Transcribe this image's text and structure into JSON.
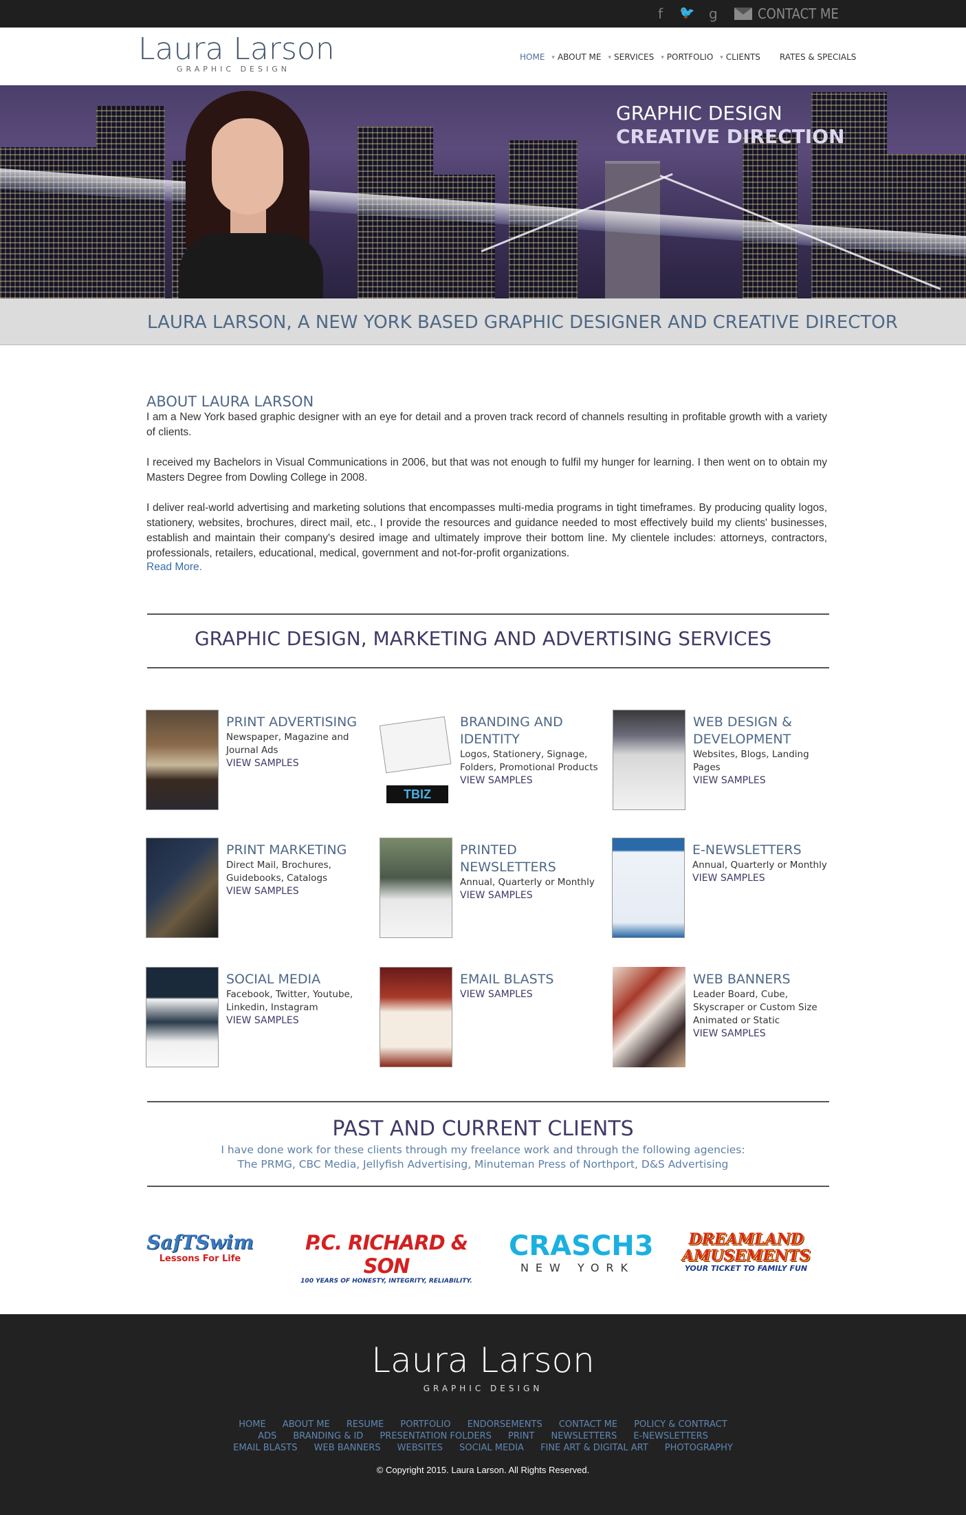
{
  "topbar": {
    "social": [
      "f",
      "twitter-bird",
      "g"
    ],
    "contact_label": "CONTACT ME"
  },
  "header": {
    "logo_name": "Laura Larson",
    "logo_tag": "GRAPHIC DESIGN",
    "nav": [
      "HOME",
      "ABOUT ME",
      "SERVICES",
      "PORTFOLIO",
      "CLIENTS",
      "RATES & SPECIALS"
    ]
  },
  "hero": {
    "line1": "GRAPHIC DESIGN",
    "line2": "CREATIVE DIRECTION"
  },
  "strip_title": "LAURA LARSON, A NEW YORK BASED GRAPHIC DESIGNER AND CREATIVE DIRECTOR",
  "about": {
    "heading": "ABOUT LAURA LARSON",
    "p1": "I am a New York based graphic designer with an eye for detail and a proven track record of channels resulting in profitable growth with a variety of clients.",
    "p2": "I received my Bachelors in Visual Communications in 2006, but that was not enough to fulfil my hunger for learning. I then went on to obtain my Masters Degree from Dowling College in 2008.",
    "p3": "I deliver real-world advertising and marketing solutions that encompasses multi-media programs in tight timeframes. By producing quality logos, stationery, websites, brochures, direct mail, etc., I provide the resources and guidance needed to most effectively build my clients' businesses, establish and maintain their company's desired image and ultimately improve their bottom line. My clientele includes: attorneys, contractors, professionals, retailers, educational, medical, government and not-for-profit organizations.",
    "read_more": "Read More."
  },
  "services_title": "GRAPHIC DESIGN, MARKETING AND ADVERTISING SERVICES",
  "services": [
    {
      "title": "PRINT ADVERTISING",
      "desc": "Newspaper, Magazine and Journal Ads",
      "link": "VIEW SAMPLES"
    },
    {
      "title": "BRANDING AND IDENTITY",
      "desc": "Logos, Stationery, Signage, Folders, Promotional Products",
      "link": "VIEW SAMPLES"
    },
    {
      "title": "WEB DESIGN & DEVELOPMENT",
      "desc": "Websites, Blogs, Landing Pages",
      "link": "VIEW SAMPLES"
    },
    {
      "title": "PRINT MARKETING",
      "desc": "Direct Mail, Brochures, Guidebooks, Catalogs",
      "link": "VIEW SAMPLES"
    },
    {
      "title": "PRINTED NEWSLETTERS",
      "desc": "Annual, Quarterly or Monthly",
      "link": "VIEW SAMPLES"
    },
    {
      "title": "E-NEWSLETTERS",
      "desc": "Annual, Quarterly or Monthly",
      "link": "VIEW SAMPLES"
    },
    {
      "title": "SOCIAL MEDIA",
      "desc": "Facebook, Twitter, Youtube, Linkedin, Instagram",
      "link": "VIEW SAMPLES"
    },
    {
      "title": "EMAIL BLASTS",
      "desc": "",
      "link": "VIEW SAMPLES"
    },
    {
      "title": "WEB BANNERS",
      "desc": "Leader Board, Cube, Skyscraper or Custom Size Animated or Static",
      "link": "VIEW SAMPLES"
    }
  ],
  "clients": {
    "title": "PAST AND CURRENT CLIENTS",
    "sub1": "I have done work for these clients through my freelance work and through the following agencies:",
    "sub2": "The PRMG, CBC Media, Jellyfish Advertising, Minuteman Press of Northport, D&S Advertising",
    "logos": [
      {
        "main": "SafTSwim",
        "sub": "Lessons For Life"
      },
      {
        "main": "P.C. RICHARD & SON",
        "sub": "100 YEARS OF HONESTY, INTEGRITY, RELIABILITY."
      },
      {
        "main": "CRASCH3",
        "sub": "NEW YORK"
      },
      {
        "main": "DREAMLAND AMUSEMENTS",
        "sub": "YOUR TICKET TO FAMILY FUN"
      }
    ]
  },
  "footer": {
    "logo_name": "Laura Larson",
    "logo_tag": "GRAPHIC DESIGN",
    "links_row1": [
      "HOME",
      "ABOUT ME",
      "RESUME",
      "PORTFOLIO",
      "ENDORSEMENTS",
      "CONTACT ME",
      "POLICY & CONTRACT"
    ],
    "links_row2": [
      "ADS",
      "BRANDING & ID",
      "PRESENTATION FOLDERS",
      "PRINT",
      "NEWSLETTERS",
      "E-NEWSLETTERS"
    ],
    "links_row3": [
      "EMAIL BLASTS",
      "WEB BANNERS",
      "WEBSITES",
      "SOCIAL MEDIA",
      "FINE ART & DIGITAL ART",
      "PHOTOGRAPHY"
    ],
    "copyright": "© Copyright 2015. Laura Larson. All Rights Reserved."
  },
  "colors": {
    "accent_blue": "#4e6886",
    "deep_purple": "#3f3a66",
    "link_blue": "#5f86b5"
  }
}
